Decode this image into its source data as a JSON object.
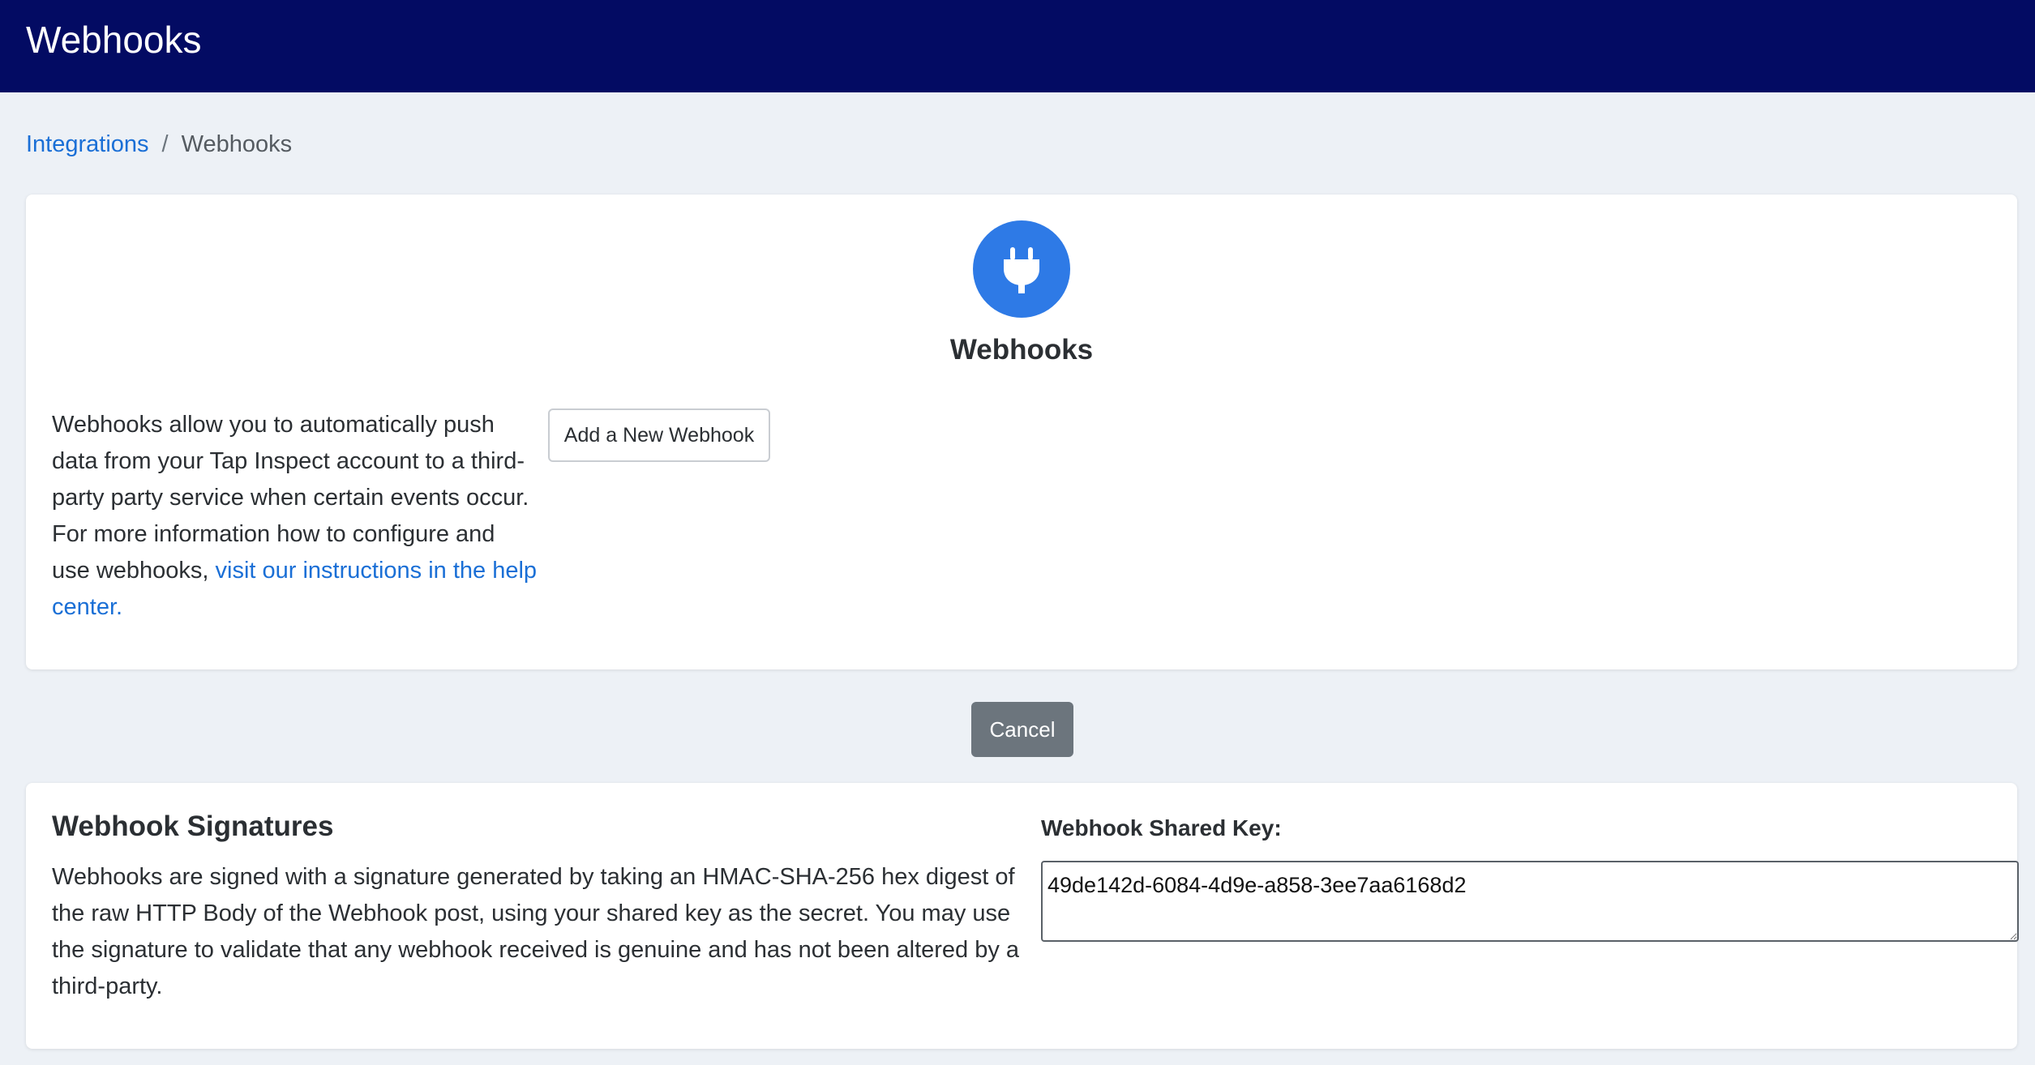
{
  "header": {
    "title": "Webhooks"
  },
  "breadcrumb": {
    "parent": "Integrations",
    "separator": "/",
    "current": "Webhooks"
  },
  "webhooks_card": {
    "icon": "plug-icon",
    "title": "Webhooks",
    "description_text": "Webhooks allow you to automatically push data from your Tap Inspect account to a third-party party service when certain events occur. For more information how to configure and use webhooks, ",
    "help_link_text": "visit our instructions in the help center.",
    "add_button_label": "Add a New Webhook"
  },
  "actions": {
    "cancel_label": "Cancel"
  },
  "signatures_card": {
    "title": "Webhook Signatures",
    "description": "Webhooks are signed with a signature generated by taking an HMAC-SHA-256 hex digest of the raw HTTP Body of the Webhook post, using your shared key as the secret. You may use the signature to validate that any webhook received is genuine and has not been altered by a third-party.",
    "shared_key_label": "Webhook Shared Key:",
    "shared_key_value": "49de142d-6084-4d9e-a858-3ee7aa6168d2"
  },
  "colors": {
    "header_bg": "#030b63",
    "page_bg": "#edf1f6",
    "accent": "#2e7ae6",
    "link": "#1a6fd6",
    "cancel_bg": "#6c757d"
  }
}
